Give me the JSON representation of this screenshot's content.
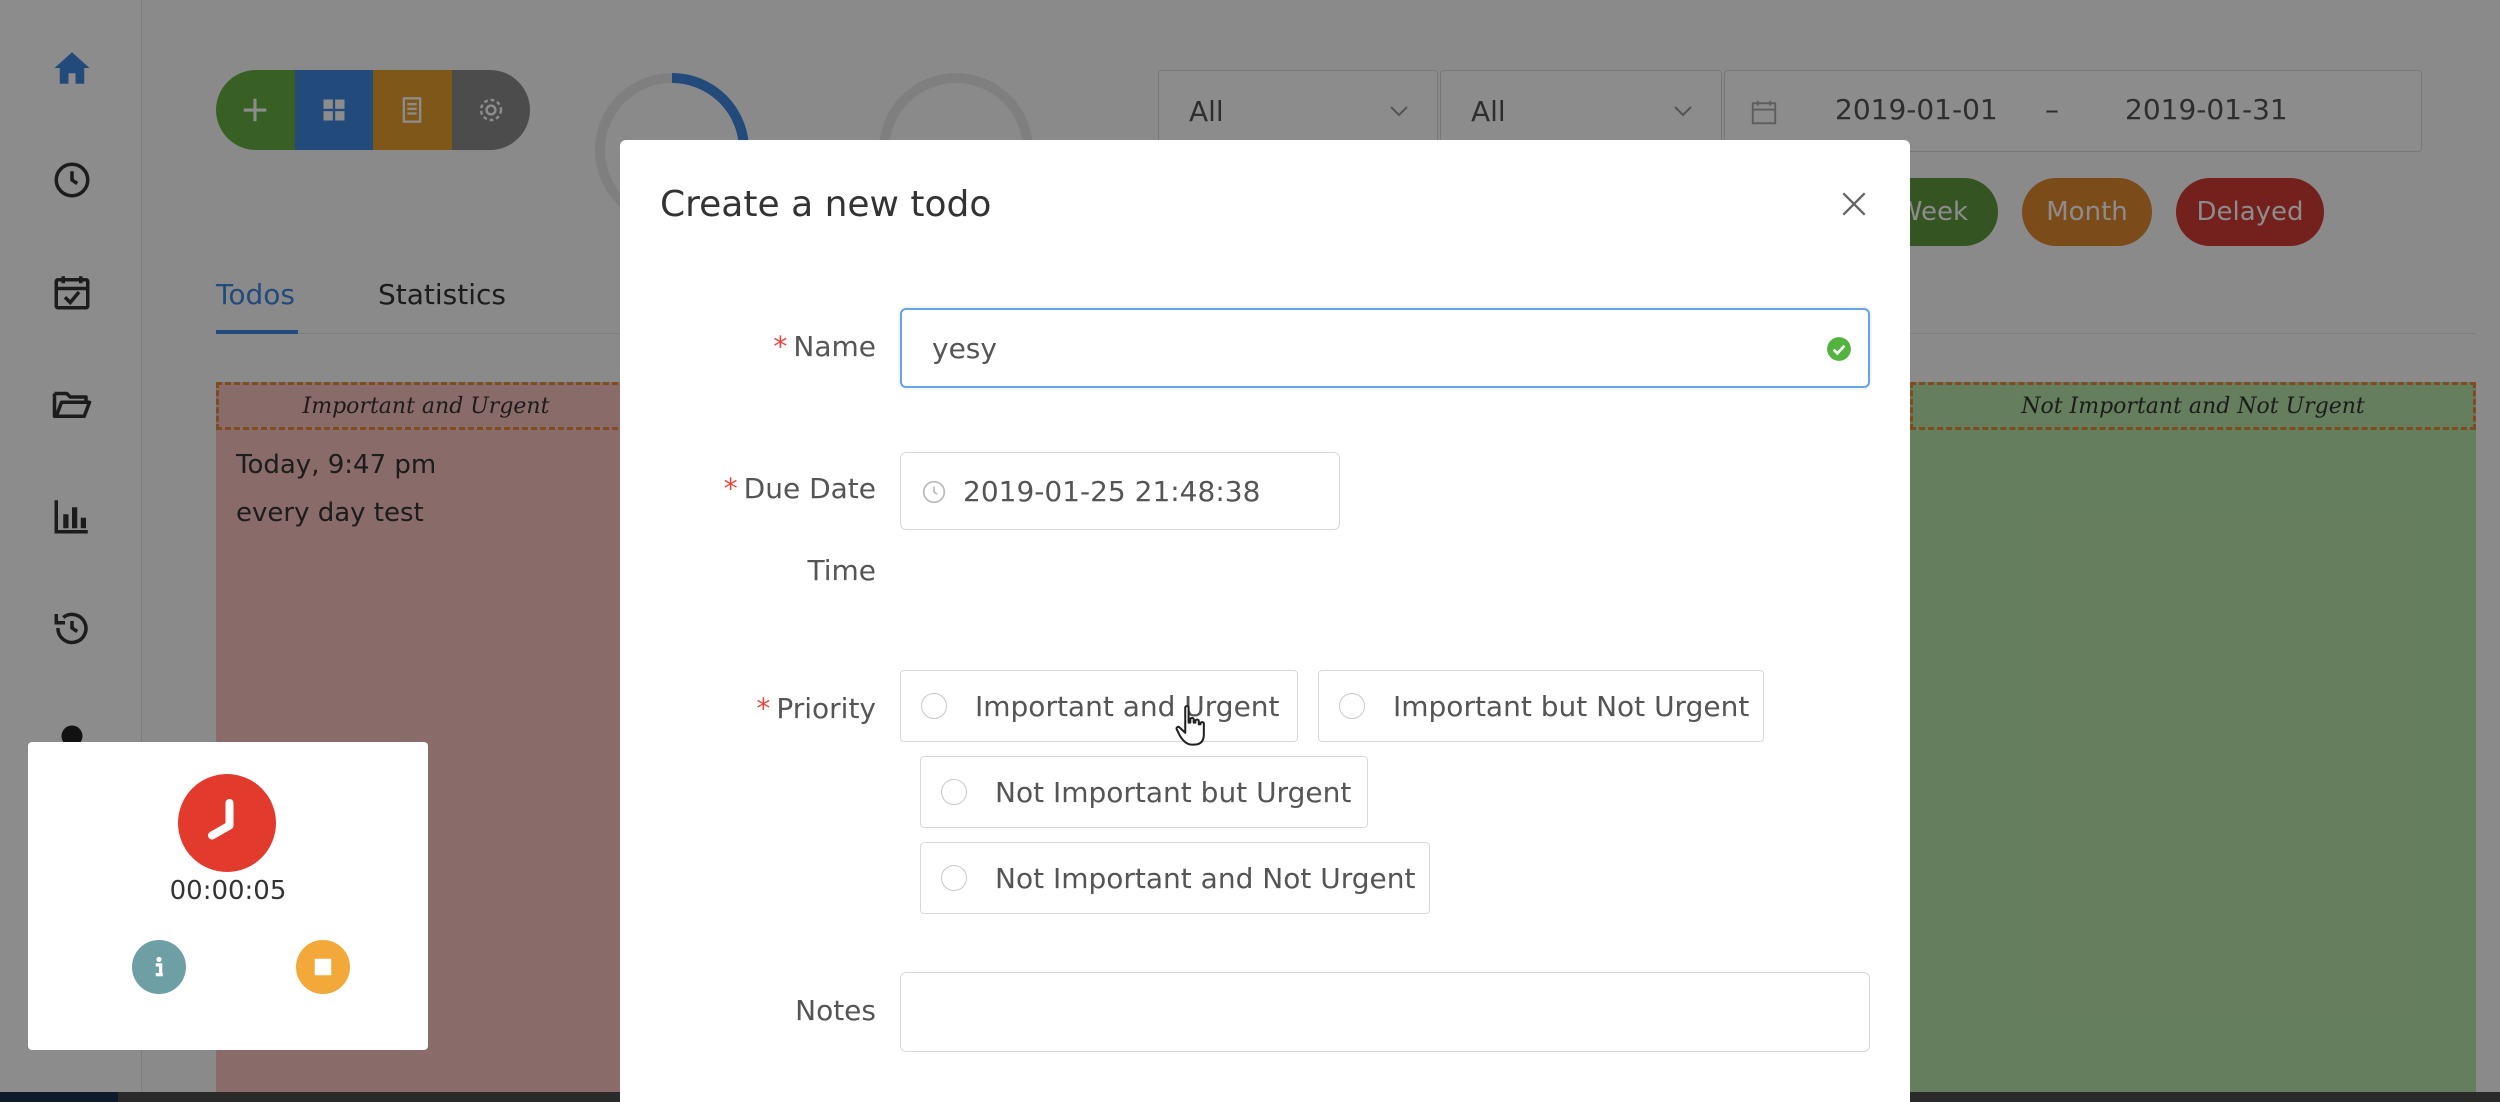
{
  "toolbar": {
    "add_icon": "plus-icon",
    "grid_icon": "grid-icon",
    "list_icon": "document-icon",
    "settings_icon": "gear-icon",
    "colors": {
      "add": "#67b043",
      "grid": "#3f87e0",
      "list": "#e79e2e",
      "settings": "#8a8a8a"
    }
  },
  "sidebar": {
    "items": [
      {
        "icon": "home-icon"
      },
      {
        "icon": "clock-icon"
      },
      {
        "icon": "calendar-check-icon"
      },
      {
        "icon": "folder-open-icon"
      },
      {
        "icon": "bar-chart-icon"
      },
      {
        "icon": "history-icon"
      }
    ]
  },
  "filters": {
    "select_one": "All",
    "select_two": "All",
    "date_start": "2019-01-01",
    "date_separator": "–",
    "date_end": "2019-01-31",
    "pills": [
      {
        "label": "Week",
        "color": "#5f9a3e"
      },
      {
        "label": "Month",
        "color": "#e0892f"
      },
      {
        "label": "Delayed",
        "color": "#d43b33"
      }
    ]
  },
  "tabs": [
    {
      "label": "Todos",
      "active": true
    },
    {
      "label": "Statistics",
      "active": false
    }
  ],
  "quadrants": {
    "q1_title": "Important and Urgent",
    "q4_title": "Not Important and Not Urgent",
    "q1_task": {
      "time": "Today, 9:47 pm",
      "name": "every day test"
    }
  },
  "timer": {
    "elapsed": "00:00:05",
    "clock_color": "#e33a2e"
  },
  "modal": {
    "title": "Create a new todo",
    "name_label": "Name",
    "name_value": "yesy",
    "due_label_line1": "Due Date",
    "due_label_line2": "Time",
    "due_value": "2019-01-25 21:48:38",
    "priority_label": "Priority",
    "priority_options": [
      "Important and Urgent",
      "Important but Not Urgent",
      "Not Important but Urgent",
      "Not Important and Not Urgent"
    ],
    "notes_label": "Notes",
    "notes_value": ""
  }
}
